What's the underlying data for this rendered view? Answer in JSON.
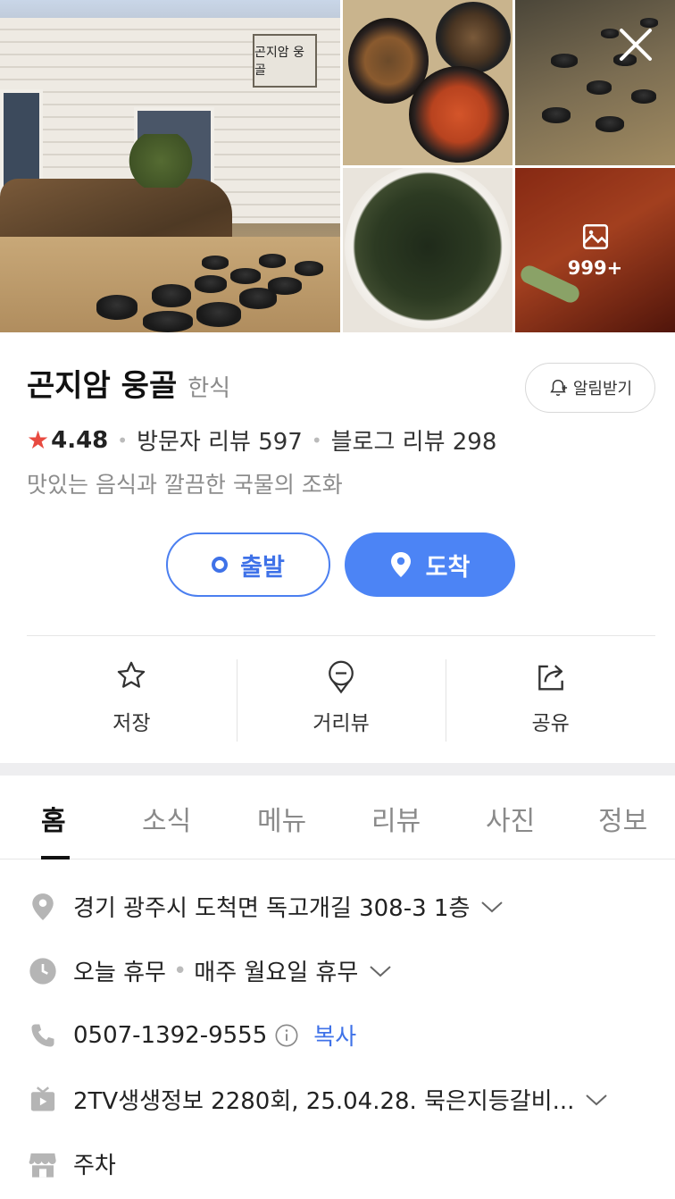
{
  "gallery": {
    "more_count": "999+"
  },
  "place": {
    "name": "곤지암 웅골",
    "category": "한식",
    "sign_text": "곤지암 웅골",
    "rating": "4.48",
    "visitor_reviews": "방문자 리뷰 597",
    "blog_reviews": "블로그 리뷰 298",
    "description": "맛있는 음식과 깔끔한 국물의 조화"
  },
  "buttons": {
    "alarm": "알림받기",
    "start": "출발",
    "arrive": "도착"
  },
  "actions": [
    {
      "label": "저장",
      "icon": "star-icon"
    },
    {
      "label": "거리뷰",
      "icon": "roadview-icon"
    },
    {
      "label": "공유",
      "icon": "share-icon"
    }
  ],
  "tabs": [
    "홈",
    "소식",
    "메뉴",
    "리뷰",
    "사진",
    "정보"
  ],
  "info": {
    "address": "경기 광주시 도척면 독고개길 308-3 1층",
    "hours_status": "오늘 휴무",
    "hours_detail": "매주 월요일 휴무",
    "phone": "0507-1392-9555",
    "copy": "복사",
    "tv": "2TV생생정보 2280회, 25.04.28. 묵은지등갈비...",
    "parking": "주차"
  },
  "colors": {
    "accent": "#4c84f5",
    "star": "#e84a40",
    "link": "#3f72e8"
  }
}
